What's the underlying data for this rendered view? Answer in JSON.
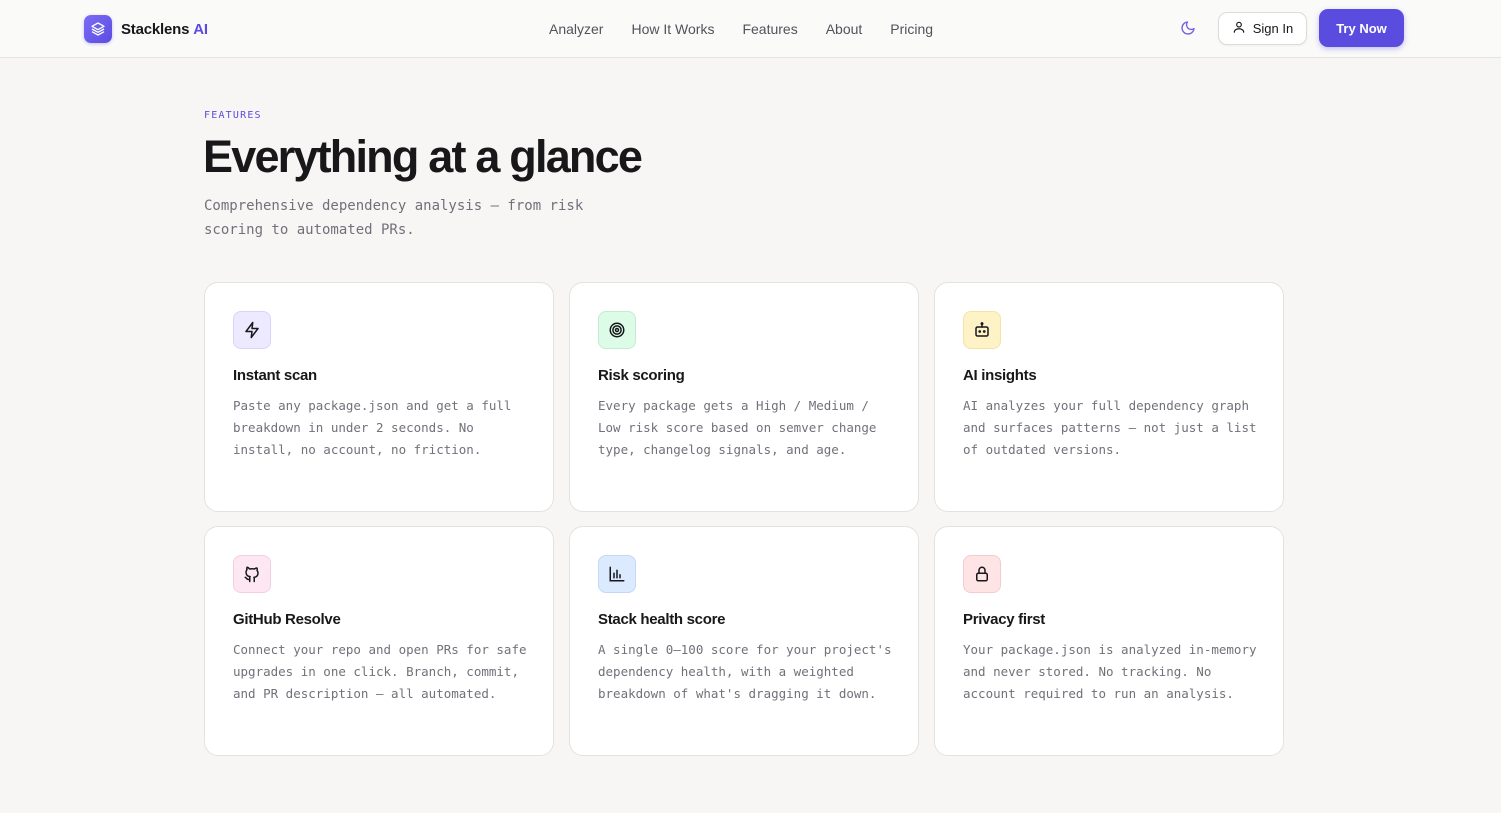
{
  "header": {
    "brand_name": "Stacklens",
    "brand_accent": "AI",
    "nav": [
      "Analyzer",
      "How It Works",
      "Features",
      "About",
      "Pricing"
    ],
    "theme_icon": "moon-icon",
    "sign_in_label": "Sign In",
    "try_now_label": "Try Now"
  },
  "hero": {
    "eyebrow": "FEATURES",
    "title": "Everything at a glance",
    "subtitle": "Comprehensive dependency analysis — from risk scoring to automated PRs."
  },
  "features": [
    {
      "icon": "lightning-icon",
      "title": "Instant scan",
      "description": "Paste any package.json and get a full breakdown in under 2 seconds. No install, no account, no friction."
    },
    {
      "icon": "target-icon",
      "title": "Risk scoring",
      "description": "Every package gets a High / Medium / Low risk score based on semver change type, changelog signals, and age."
    },
    {
      "icon": "robot-icon",
      "title": "AI insights",
      "description": "AI analyzes your full dependency graph and surfaces patterns — not just a list of outdated versions."
    },
    {
      "icon": "github-icon",
      "title": "GitHub Resolve",
      "description": "Connect your repo and open PRs for safe upgrades in one click. Branch, commit, and PR description — all automated."
    },
    {
      "icon": "bar-chart-icon",
      "title": "Stack health score",
      "description": "A single 0–100 score for your project's dependency health, with a weighted breakdown of what's dragging it down."
    },
    {
      "icon": "lock-icon",
      "title": "Privacy first",
      "description": "Your package.json is analyzed in-memory and never stored. No tracking. No account required to run an analysis."
    }
  ],
  "colors": {
    "accent": "#5b4ce0",
    "background": "#f7f6f4",
    "card": "#ffffff",
    "icon_bg_purple": "#ede9fe",
    "icon_bg_green": "#dcfce7",
    "icon_bg_amber": "#fef3c7",
    "icon_bg_pink": "#fce7f3",
    "icon_bg_blue": "#dbeafe",
    "icon_bg_rose": "#ffe4e6"
  }
}
